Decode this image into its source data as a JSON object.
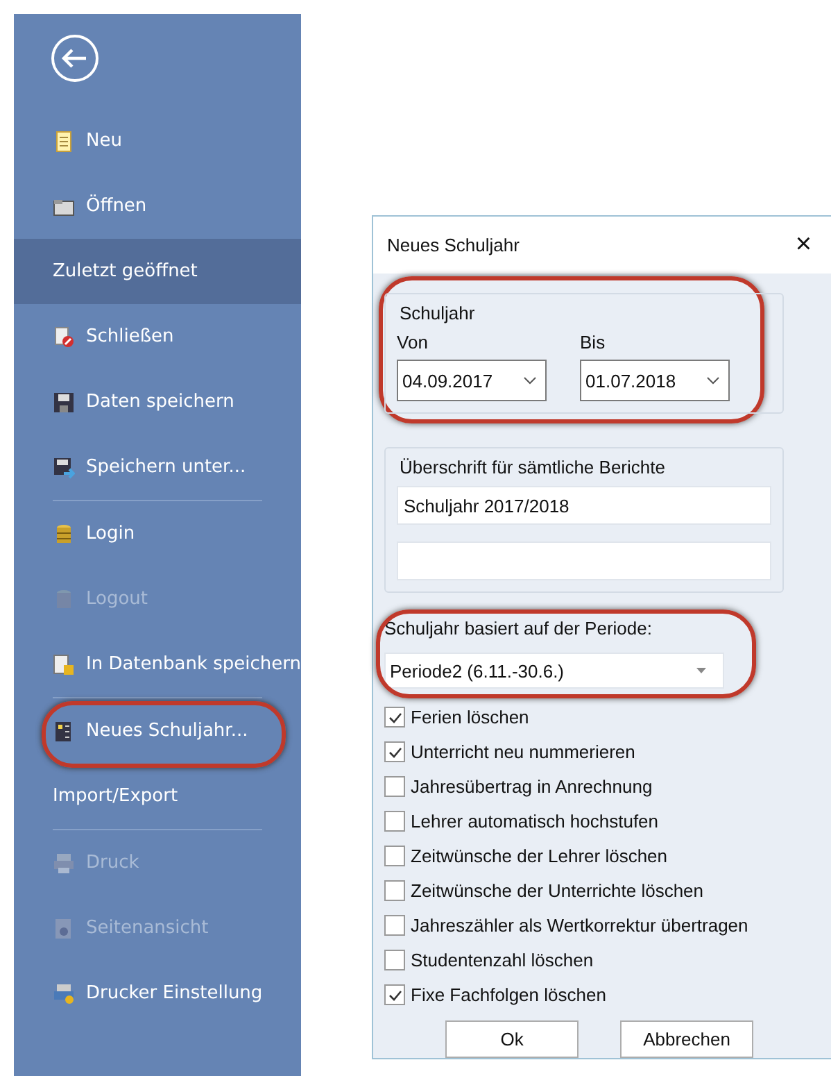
{
  "sidebar": {
    "items": [
      {
        "kind": "back"
      },
      {
        "kind": "command",
        "label": "Neu",
        "disabled": false,
        "selected": false,
        "highlighted": false
      },
      {
        "kind": "command",
        "label": "Öffnen",
        "disabled": false,
        "selected": false,
        "highlighted": false
      },
      {
        "kind": "heading",
        "label": "Zuletzt geöffnet",
        "selected": true
      },
      {
        "kind": "command",
        "label": "Schließen",
        "disabled": false,
        "selected": false,
        "highlighted": false
      },
      {
        "kind": "command",
        "label": "Daten speichern",
        "disabled": false,
        "selected": false,
        "highlighted": false
      },
      {
        "kind": "command",
        "label": "Speichern unter...",
        "disabled": false,
        "selected": false,
        "highlighted": false
      },
      {
        "kind": "divider"
      },
      {
        "kind": "command",
        "label": "Login",
        "disabled": false,
        "selected": false,
        "highlighted": false
      },
      {
        "kind": "command",
        "label": "Logout",
        "disabled": true,
        "selected": false,
        "highlighted": false
      },
      {
        "kind": "command",
        "label": "In Datenbank speichern",
        "disabled": false,
        "selected": false,
        "highlighted": false
      },
      {
        "kind": "divider"
      },
      {
        "kind": "command",
        "label": "Neues Schuljahr...",
        "disabled": false,
        "selected": false,
        "highlighted": true
      },
      {
        "kind": "heading",
        "label": "Import/Export",
        "selected": false
      },
      {
        "kind": "divider"
      },
      {
        "kind": "command",
        "label": "Druck",
        "disabled": true,
        "selected": false,
        "highlighted": false
      },
      {
        "kind": "command",
        "label": "Seitenansicht",
        "disabled": true,
        "selected": false,
        "highlighted": false
      },
      {
        "kind": "command",
        "label": "Drucker Einstellung",
        "disabled": false,
        "selected": false,
        "highlighted": false
      }
    ]
  },
  "dialog": {
    "title": "Neues Schuljahr",
    "close": "×",
    "schuljahr": {
      "title": "Schuljahr",
      "highlighted": true,
      "from_label": "Von",
      "from_value": "04.09.2017",
      "to_label": "Bis",
      "to_value": "01.07.2018"
    },
    "heading_group": {
      "title": "Überschrift für sämtliche Berichte",
      "line_1": "Schuljahr 2017/2018"
    },
    "period": {
      "label": "Schuljahr basiert auf der Periode:",
      "value": "Periode2 (6.11.-30.6.)",
      "highlighted": true
    },
    "options": [
      {
        "label": "Ferien löschen",
        "checked": true
      },
      {
        "label": "Unterricht neu nummerieren",
        "checked": true
      },
      {
        "label": "Jahresübertrag in Anrechnung",
        "checked": false
      },
      {
        "label": "Lehrer automatisch hochstufen",
        "checked": false
      },
      {
        "label": "Zeitwünsche der Lehrer löschen",
        "checked": false
      },
      {
        "label": "Zeitwünsche der Unterrichte löschen",
        "checked": false
      },
      {
        "label": "Jahreszähler als Wertkorrektur übertragen",
        "checked": false
      },
      {
        "label": "Studentenzahl löschen",
        "checked": false
      },
      {
        "label": "Fixe Fachfolgen löschen",
        "checked": true
      }
    ],
    "buttons": [
      "Ok",
      "Abbrechen"
    ]
  }
}
